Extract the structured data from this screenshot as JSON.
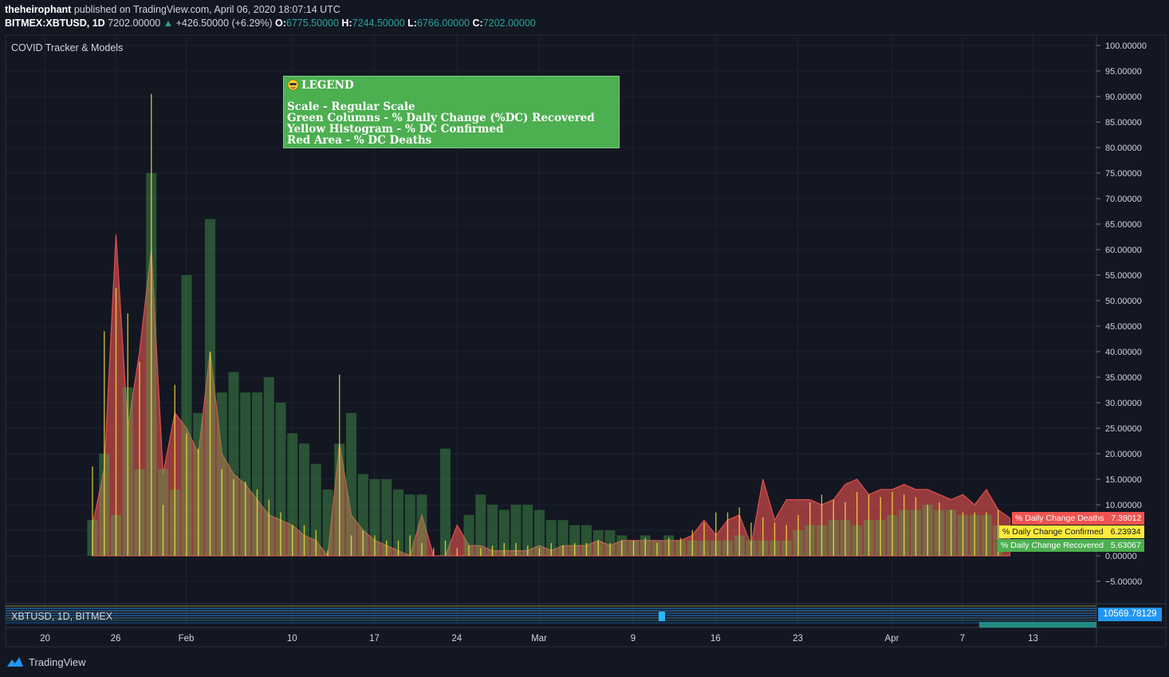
{
  "header": {
    "author": "theheirophant",
    "published": "published on TradingView.com, April 06, 2020 18:07:14 UTC",
    "symbol": "BITMEX:XBTUSD, 1D",
    "last": "7202.00000",
    "change_arrow": "▲",
    "change": "+426.50000 (+6.29%)",
    "open_label": "O:",
    "open": "6775.50000",
    "high_label": "H:",
    "high": "7244.50000",
    "low_label": "L:",
    "low": "6766.00000",
    "close_label": "C:",
    "close": "7202.00000"
  },
  "indicator": {
    "title": "COVID Tracker & Models"
  },
  "legend": {
    "title": "LEGEND",
    "lines": [
      "Scale - Regular Scale",
      "Green Columns - % Daily Change (%DC) Recovered",
      "Yellow Histogram - % DC Confirmed",
      "Red Area - % DC Deaths"
    ]
  },
  "value_tags": [
    {
      "label": "% Daily Change Deaths",
      "value": "7.38012",
      "bg": "#ef5350",
      "fg": "#ffffff"
    },
    {
      "label": "% Daily Change Confirmed",
      "value": "6.23934",
      "bg": "#ffeb3b",
      "fg": "#131722"
    },
    {
      "label": "% Daily Change Recovered",
      "value": "5.63067",
      "bg": "#4caf50",
      "fg": "#ffffff"
    }
  ],
  "subpane": {
    "title": "XBTUSD, 1D, BITMEX",
    "price": "10569.78129"
  },
  "footer": {
    "brand": "TradingView"
  },
  "colors": {
    "background": "#131722",
    "recovered": "#4caf50",
    "confirmed": "#ffeb3b",
    "deaths": "#ef5350",
    "grid": "#1e2230",
    "up": "#26a69a"
  },
  "chart_data": {
    "type": "bar",
    "title": "COVID Tracker & Models",
    "ylim": [
      -5,
      100
    ],
    "y_ticks": [
      "100.00000",
      "95.00000",
      "90.00000",
      "85.00000",
      "80.00000",
      "75.00000",
      "70.00000",
      "65.00000",
      "60.00000",
      "55.00000",
      "50.00000",
      "45.00000",
      "40.00000",
      "35.00000",
      "30.00000",
      "25.00000",
      "20.00000",
      "15.00000",
      "10.00000",
      "5.00000",
      "0.00000",
      "−5.00000"
    ],
    "x_ticks": [
      "20",
      "26",
      "Feb",
      "10",
      "17",
      "24",
      "Mar",
      "9",
      "16",
      "23",
      "Apr",
      "7",
      "13"
    ],
    "grid": true,
    "x_start_date": "2020-01-22",
    "series": [
      {
        "name": "% Daily Change Recovered",
        "style": "columns",
        "values": [
          7,
          20,
          8,
          33,
          17,
          75,
          17,
          13,
          55,
          28,
          66,
          32,
          36,
          32,
          32,
          35,
          30,
          24,
          22,
          18,
          13,
          22,
          28,
          16,
          15,
          15,
          13,
          12,
          12,
          0,
          21,
          0,
          8,
          12,
          10,
          9,
          10,
          10,
          9,
          7,
          7,
          6,
          6,
          5,
          5,
          4,
          3,
          4,
          3,
          4,
          3,
          3,
          3,
          3,
          3,
          4,
          3,
          3,
          3,
          3,
          5,
          6,
          6,
          7,
          7,
          6,
          7,
          7,
          8,
          9,
          9,
          10,
          9,
          9,
          8,
          8,
          8,
          6
        ]
      },
      {
        "name": "% Daily Change Confirmed",
        "style": "histogram",
        "values": [
          17.5,
          44,
          52.5,
          47.5,
          38,
          90.5,
          10,
          33.5,
          24,
          21,
          40,
          17,
          15,
          14.5,
          13,
          11,
          8.5,
          6,
          6,
          5,
          1,
          35.5,
          4,
          5,
          4,
          3,
          3,
          4,
          2.5,
          1.5,
          3,
          1.5,
          2,
          1.5,
          2,
          2.5,
          2.5,
          2,
          1.5,
          2.5,
          2,
          2.5,
          2.5,
          3,
          2.5,
          3,
          3,
          3.5,
          2.5,
          3.5,
          3.5,
          5,
          6.5,
          8.5,
          8.5,
          9.5,
          6.5,
          7.5,
          6.5,
          6,
          8,
          10.5,
          12,
          11,
          10.5,
          12.5,
          12,
          11.5,
          12.5,
          12,
          11.5,
          10,
          10.5,
          9,
          8.5,
          8.5,
          8.5,
          9
        ]
      },
      {
        "name": "% Daily Change Deaths",
        "style": "area",
        "values": [
          6,
          17,
          63,
          25,
          40,
          60,
          16,
          28,
          25,
          20,
          40,
          20,
          16,
          14,
          11,
          8,
          7,
          6,
          4,
          3,
          0,
          22,
          8,
          5,
          3,
          2,
          1,
          0,
          8,
          0,
          0,
          6,
          2,
          2,
          1,
          1,
          1,
          1,
          2,
          1,
          2,
          2,
          2,
          3,
          2,
          3,
          3,
          3,
          3,
          3,
          3,
          4,
          7,
          4,
          7,
          8,
          2,
          15,
          7,
          11,
          11,
          11,
          10,
          11,
          14,
          15,
          12,
          13,
          13,
          14,
          13,
          13,
          12,
          11,
          12,
          10,
          13,
          9,
          7.4
        ]
      }
    ]
  }
}
